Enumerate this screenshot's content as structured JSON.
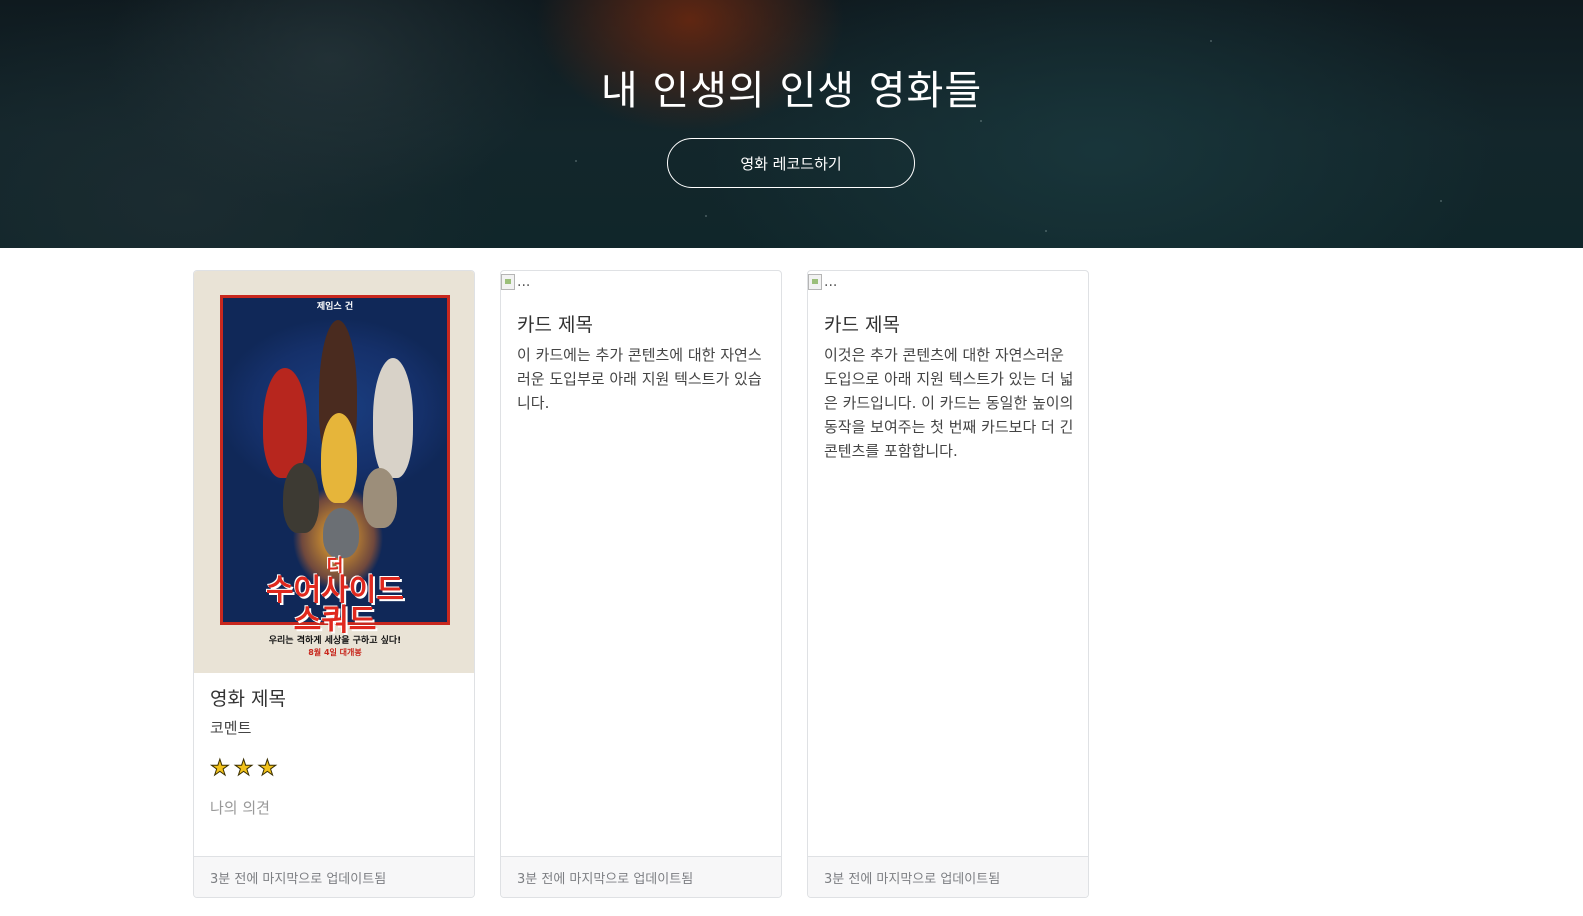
{
  "hero": {
    "title": "내 인생의 인생 영화들",
    "button_label": "영화 레코드하기"
  },
  "cards": [
    {
      "title": "영화 제목",
      "comment": "코멘트",
      "rating": 3,
      "stars": "★★★",
      "opinion": "나의 의견",
      "footer": "3분 전에 마지막으로 업데이트됨",
      "poster": {
        "top_text": "제임스 건",
        "logo_small": "더",
        "logo_line1": "수어사이드",
        "logo_line2": "스쿼드",
        "tagline": "우리는 격하게 세상을 구하고 싶다!",
        "date": "8월 4일 대개봉"
      }
    },
    {
      "image_alt": "...",
      "title": "카드 제목",
      "text": "이 카드에는 추가 콘텐츠에 대한 자연스러운 도입부로 아래 지원 텍스트가 있습니다.",
      "footer": "3분 전에 마지막으로 업데이트됨"
    },
    {
      "image_alt": "...",
      "title": "카드 제목",
      "text": "이것은 추가 콘텐츠에 대한 자연스러운 도입으로 아래 지원 텍스트가 있는 더 넓은 카드입니다. 이 카드는 동일한 높이의 동작을 보여주는 첫 번째 카드보다 더 긴 콘텐츠를 포함합니다.",
      "footer": "3분 전에 마지막으로 업데이트됨"
    }
  ],
  "colors": {
    "star": "#f2c21b",
    "footer_bg": "#f7f7f8",
    "border": "#dfe1e4"
  }
}
